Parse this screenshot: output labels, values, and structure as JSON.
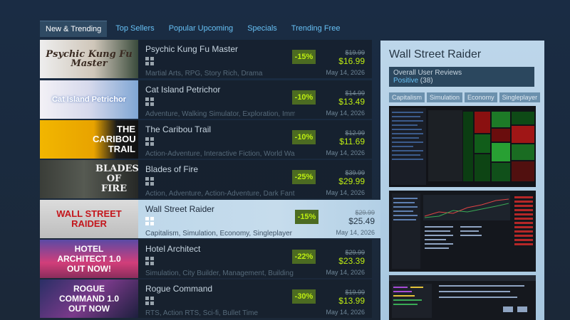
{
  "tabs": [
    {
      "label": "New & Trending",
      "active": true
    },
    {
      "label": "Top Sellers"
    },
    {
      "label": "Popular Upcoming"
    },
    {
      "label": "Specials"
    },
    {
      "label": "Trending Free"
    }
  ],
  "games": [
    {
      "title": "Psychic Kung Fu Master",
      "tags": "Martial Arts, RPG, Story Rich, Drama",
      "discount": "-15%",
      "original": "$19.99",
      "final": "$16.99",
      "date": "May 14, 2026",
      "capsule": "Psychic Kung Fu Master"
    },
    {
      "title": "Cat Island Petrichor",
      "tags": "Adventure, Walking Simulator, Exploration, Immersive",
      "discount": "-10%",
      "original": "$14.99",
      "final": "$13.49",
      "date": "May 14, 2026",
      "capsule": "Cat Island Petrichor"
    },
    {
      "title": "The Caribou Trail",
      "tags": "Action-Adventure, Interactive Fiction, World War I, F",
      "discount": "-10%",
      "original": "$12.99",
      "final": "$11.69",
      "date": "May 14, 2026",
      "capsule": "THE CARIBOU TRAIL"
    },
    {
      "title": "Blades of Fire",
      "tags": "Action, Adventure, Action-Adventure, Dark Fantasy",
      "discount": "-25%",
      "original": "$39.99",
      "final": "$29.99",
      "date": "May 14, 2026",
      "capsule": "BLADES OF FIRE"
    },
    {
      "title": "Wall Street Raider",
      "tags": "Capitalism, Simulation, Economy, Singleplayer",
      "discount": "-15%",
      "original": "$29.99",
      "final": "$25.49",
      "date": "May 14, 2026",
      "capsule": "WALL STREET RAIDER"
    },
    {
      "title": "Hotel Architect",
      "tags": "Simulation, City Builder, Management, Building",
      "discount": "-22%",
      "original": "$29.99",
      "final": "$23.39",
      "date": "May 14, 2026",
      "capsule": "HOTEL ARCHITECT 1.0 OUT NOW!"
    },
    {
      "title": "Rogue Command",
      "tags": "RTS, Action RTS, Sci-fi, Bullet Time",
      "discount": "-30%",
      "original": "$19.99",
      "final": "$13.99",
      "date": "May 14, 2026",
      "capsule": "ROGUE COMMAND 1.0 OUT NOW"
    }
  ],
  "panel": {
    "title": "Wall Street Raider",
    "reviews_label": "Overall User Reviews",
    "reviews_value": "Positive",
    "reviews_count": "(38)",
    "tags": [
      "Capitalism",
      "Simulation",
      "Economy",
      "Singleplayer"
    ]
  },
  "colors": {
    "accent_link": "#67c1f5",
    "discount_bg": "#4c6b22",
    "discount_text": "#beee11",
    "hover_bg": "#c6dcec"
  }
}
